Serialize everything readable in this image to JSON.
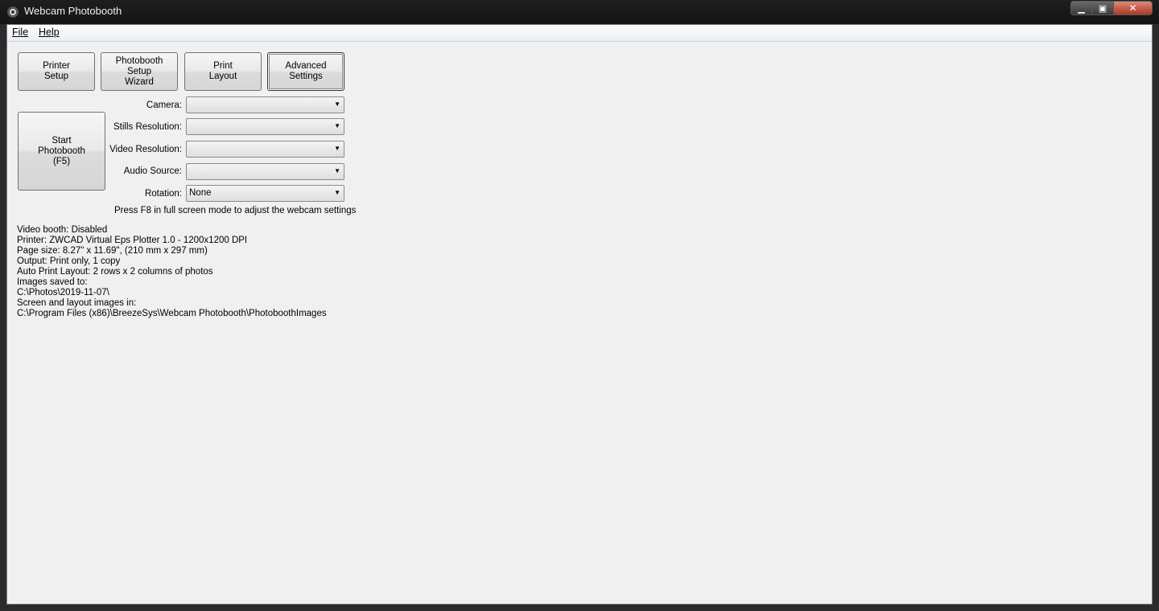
{
  "window": {
    "title": "Webcam Photobooth"
  },
  "menu": {
    "file": "File",
    "help": "Help"
  },
  "toolbar": {
    "printer_setup": "Printer\nSetup",
    "setup_wizard": "Photobooth\nSetup\nWizard",
    "print_layout": "Print\nLayout",
    "advanced_settings": "Advanced\nSettings"
  },
  "start_button": "Start\nPhotobooth\n(F5)",
  "fields": {
    "camera": {
      "label": "Camera:",
      "value": ""
    },
    "stills": {
      "label": "Stills Resolution:",
      "value": ""
    },
    "video": {
      "label": "Video Resolution:",
      "value": ""
    },
    "audio": {
      "label": "Audio Source:",
      "value": ""
    },
    "rotation": {
      "label": "Rotation:",
      "value": "None"
    }
  },
  "hint": "Press F8 in full screen mode to adjust the webcam settings",
  "info_lines": [
    "Video booth: Disabled",
    "Printer: ZWCAD Virtual Eps Plotter 1.0 - 1200x1200 DPI",
    "Page size: 8.27\" x 11.69\", (210 mm x 297 mm)",
    "Output: Print only, 1 copy",
    "Auto Print Layout: 2 rows x 2 columns of photos",
    "Images saved to:",
    "C:\\Photos\\2019-11-07\\",
    "Screen and layout images in:",
    "C:\\Program Files (x86)\\BreezeSys\\Webcam Photobooth\\PhotoboothImages"
  ],
  "icons": {
    "app": "camera-icon",
    "minimize": "minimize-icon",
    "maximize": "maximize-icon",
    "close": "close-icon",
    "dropdown": "chevron-down-icon"
  }
}
